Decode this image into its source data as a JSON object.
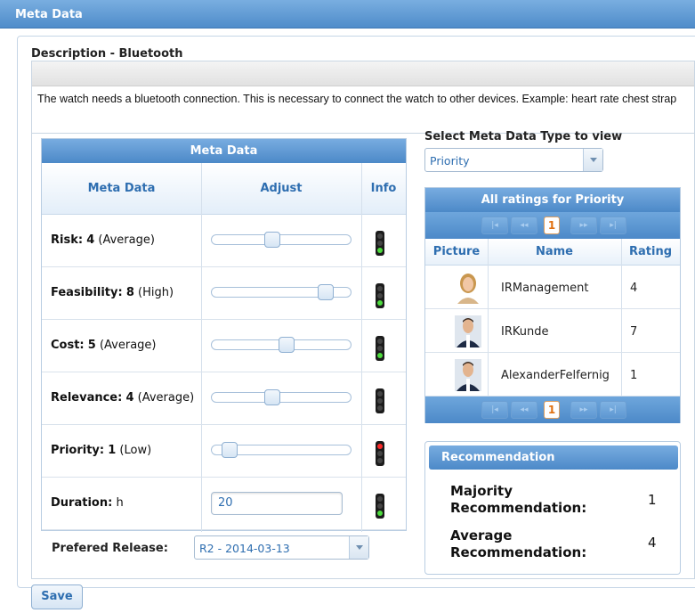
{
  "header": {
    "title": "Meta Data"
  },
  "description": {
    "title": "Description - Bluetooth",
    "text": "The watch needs a bluetooth connection. This is necessary to connect the watch to other devices. Example: heart rate chest strap"
  },
  "meta_grid": {
    "title": "Meta Data",
    "columns": [
      "Meta Data",
      "Adjust",
      "Info"
    ],
    "rows": [
      {
        "name": "Risk:",
        "value": "4",
        "qual": "(Average)",
        "level": 0.43,
        "light": "green"
      },
      {
        "name": "Feasibility:",
        "value": "8",
        "qual": "(High)",
        "level": 0.86,
        "light": "green"
      },
      {
        "name": "Cost:",
        "value": "5",
        "qual": "(Average)",
        "level": 0.54,
        "light": "green"
      },
      {
        "name": "Relevance:",
        "value": "4",
        "qual": "(Average)",
        "level": 0.43,
        "light": "none"
      },
      {
        "name": "Priority:",
        "value": "1",
        "qual": "(Low)",
        "level": 0.08,
        "light": "red"
      }
    ],
    "duration": {
      "name": "Duration:",
      "unit": "h",
      "value": "20",
      "light": "green"
    }
  },
  "release": {
    "label": "Prefered Release:",
    "value": "R2 - 2014-03-13"
  },
  "type_select": {
    "label": "Select Meta Data Type to view",
    "value": "Priority"
  },
  "ratings": {
    "title": "All ratings for Priority",
    "page": "1",
    "columns": [
      "Picture",
      "Name",
      "Rating"
    ],
    "rows": [
      {
        "name": "IRManagement",
        "rating": "4",
        "avatar": "female-avatar"
      },
      {
        "name": "IRKunde",
        "rating": "7",
        "avatar": "male-avatar"
      },
      {
        "name": "AlexanderFelfernig",
        "rating": "1",
        "avatar": "male-avatar"
      }
    ]
  },
  "recommendation": {
    "title": "Recommendation",
    "majority_label": "Majority Recommendation:",
    "majority_value": "1",
    "average_label": "Average Recommendation:",
    "average_value": "4"
  },
  "actions": {
    "save": "Save"
  },
  "colors": {
    "accent": "#4c89c8",
    "link": "#2e6eb0",
    "light_on_red": "#ff2a2a",
    "light_on_green": "#4ddc3d"
  },
  "icons": {
    "traffic_light": "traffic-light-icon",
    "dropdown": "chevron-down-icon"
  }
}
